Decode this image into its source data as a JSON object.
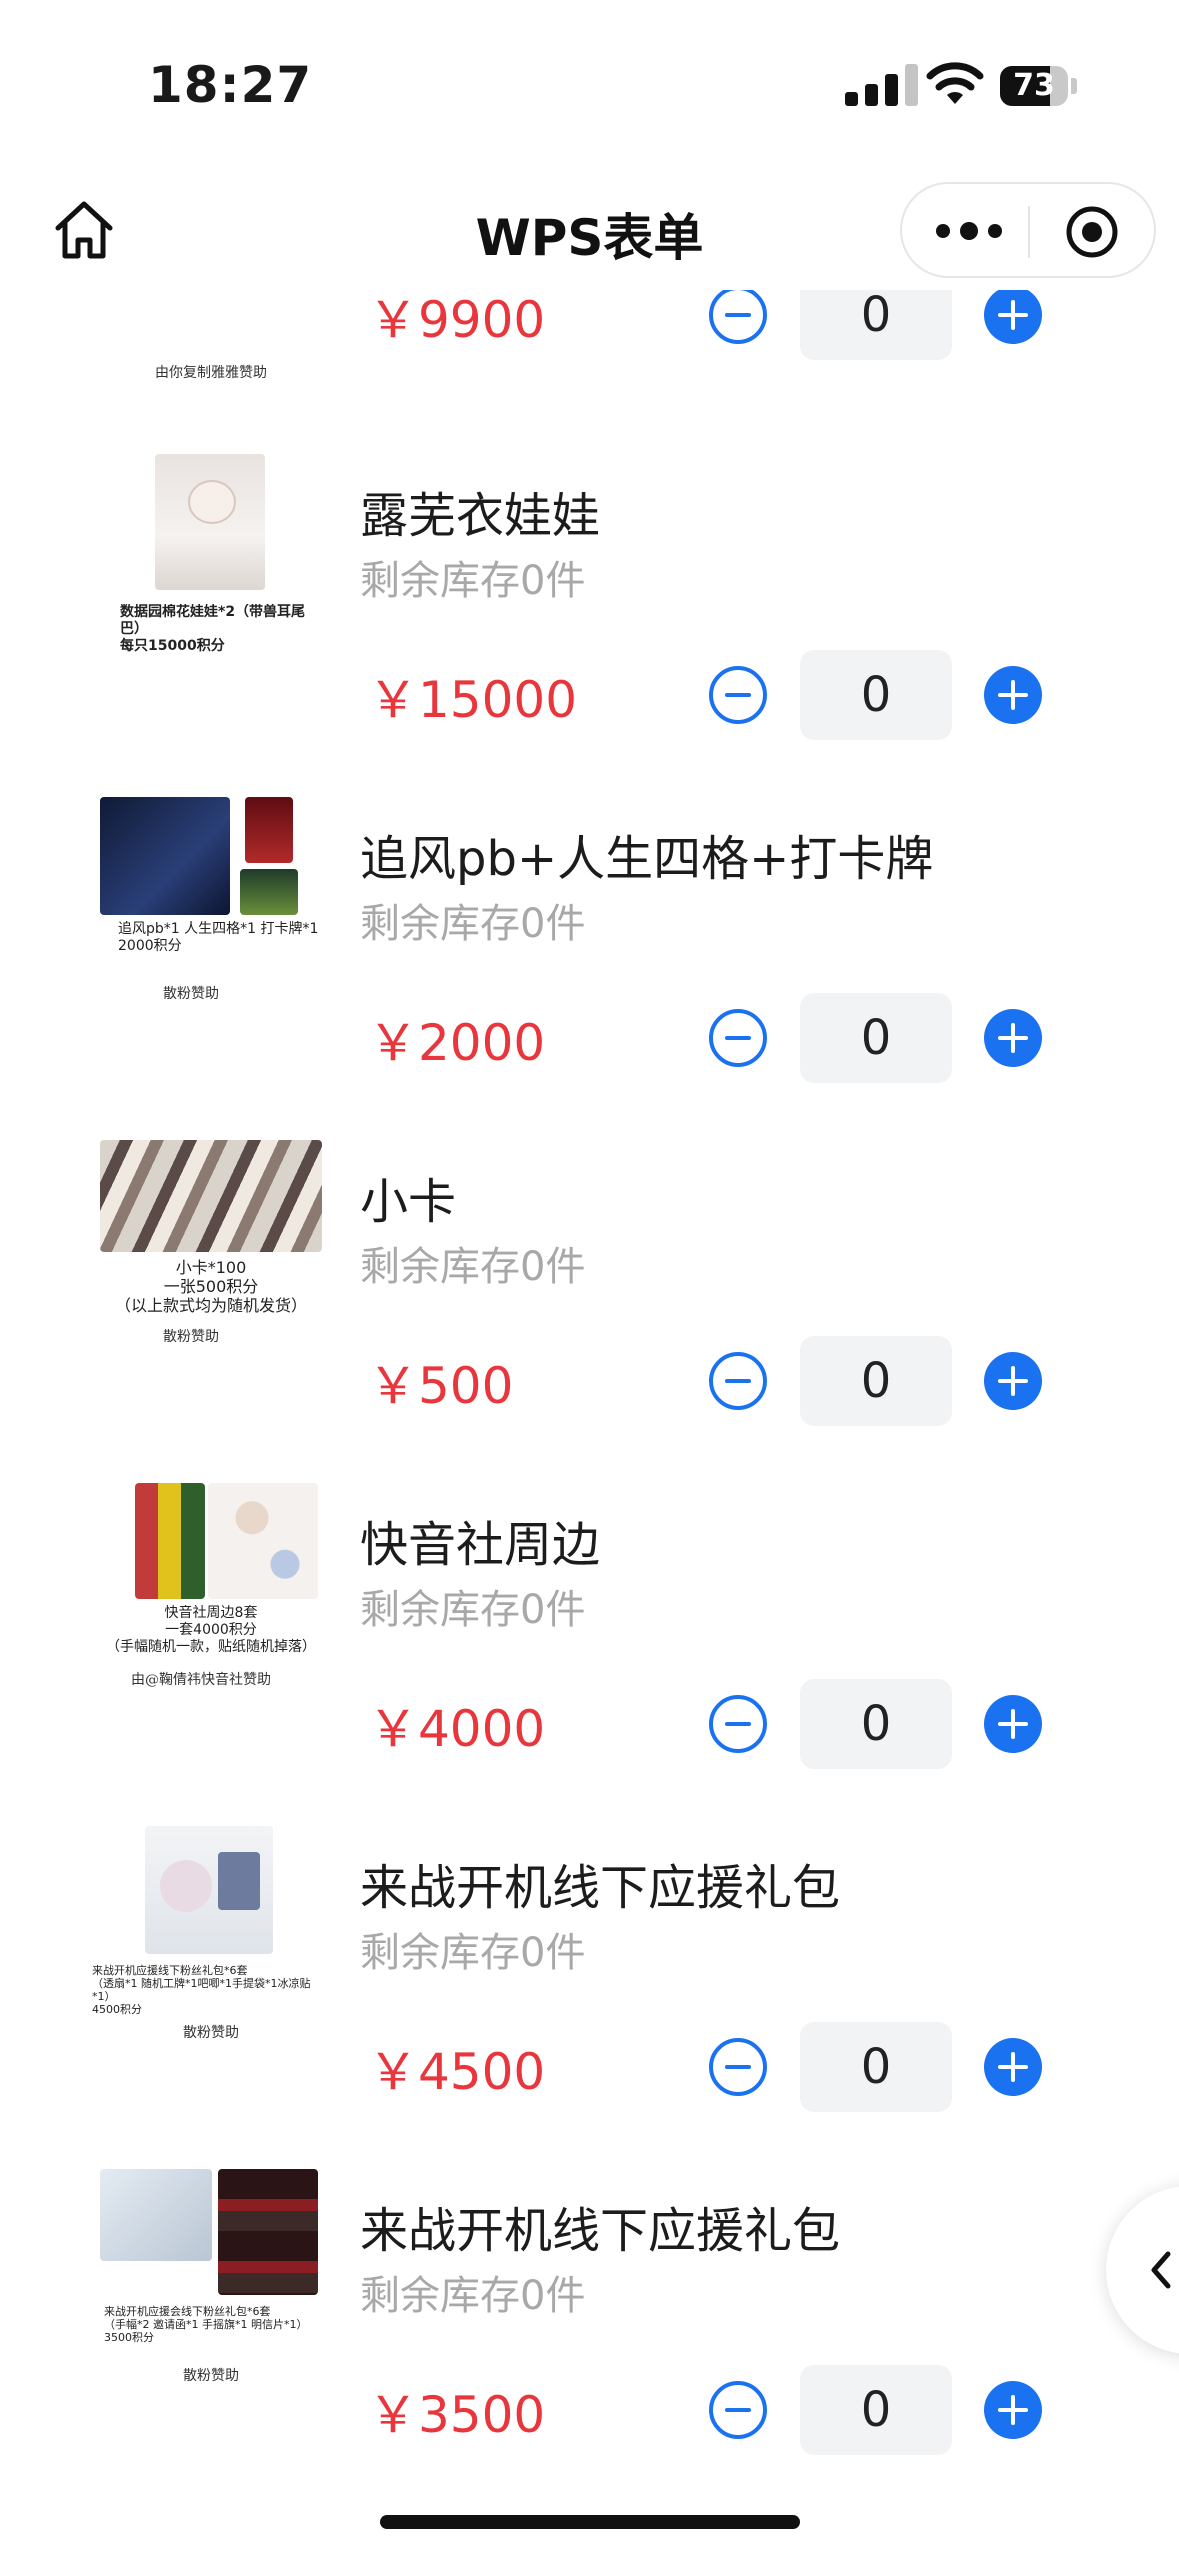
{
  "status_bar": {
    "time": "18:27",
    "battery": "73",
    "battery_level": 0.73
  },
  "nav": {
    "title": "WPS表单"
  },
  "colors": {
    "accent": "#1a72f0",
    "price": "#e8363c",
    "stock": "#a8a8a8",
    "qty_bg": "#f2f3f5"
  },
  "items": [
    {
      "name": "",
      "stock": "",
      "price": "￥9900",
      "qty": "0",
      "thumb_caption": "",
      "thumb_sign": "由你复制雅雅赞助"
    },
    {
      "name": "露芜衣娃娃",
      "stock": "剩余库存0件",
      "price": "￥15000",
      "qty": "0",
      "thumb_caption": "数据园棉花娃娃*2（带兽耳尾巴）\n每只15000积分",
      "thumb_sign": ""
    },
    {
      "name": "追风pb+人生四格+打卡牌",
      "stock": "剩余库存0件",
      "price": "￥2000",
      "qty": "0",
      "thumb_caption": "追风pb*1 人生四格*1 打卡牌*1\n2000积分",
      "thumb_sign": "散粉赞助"
    },
    {
      "name": "小卡",
      "stock": "剩余库存0件",
      "price": "￥500",
      "qty": "0",
      "thumb_caption": "小卡*100\n一张500积分\n（以上款式均为随机发货）",
      "thumb_sign": "散粉赞助"
    },
    {
      "name": "快音社周边",
      "stock": "剩余库存0件",
      "price": "￥4000",
      "qty": "0",
      "thumb_caption": "快音社周边8套\n一套4000积分\n（手幅随机一款，贴纸随机掉落）",
      "thumb_sign": "由@鞠倩祎快音社赞助"
    },
    {
      "name": "来战开机线下应援礼包",
      "stock": "剩余库存0件",
      "price": "￥4500",
      "qty": "0",
      "thumb_caption": "来战开机应援线下粉丝礼包*6套\n（透扇*1 随机工牌*1吧唧*1手提袋*1冰凉贴*1）\n4500积分",
      "thumb_sign": "散粉赞助"
    },
    {
      "name": "来战开机线下应援礼包",
      "stock": "剩余库存0件",
      "price": "￥3500",
      "qty": "0",
      "thumb_caption": "来战开机应援会线下粉丝礼包*6套\n（手幅*2 邀请函*1 手摇旗*1 明信片*1）\n3500积分",
      "thumb_sign": "散粉赞助"
    }
  ]
}
